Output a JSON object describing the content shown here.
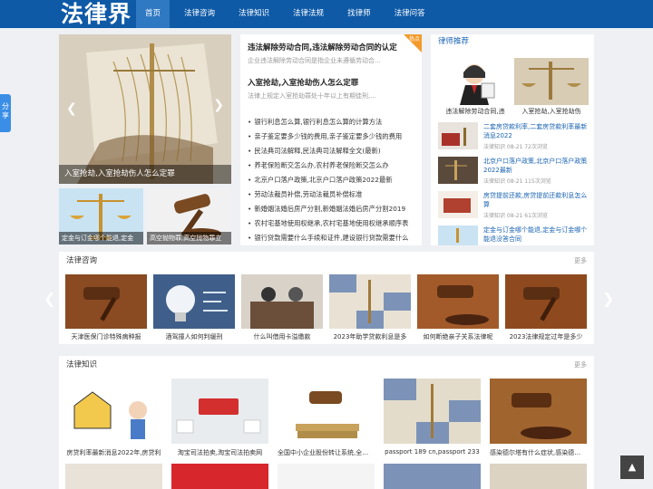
{
  "header": {
    "logo": "法律界",
    "nav": [
      "首页",
      "法律咨询",
      "法律知识",
      "法律法规",
      "找律师",
      "法律问答"
    ],
    "active_index": 0
  },
  "share": {
    "label": "分享"
  },
  "slider": {
    "caption": "入室抢劫,入室抢劫伤人怎么定罪",
    "prev_icon": "chevron-left-icon",
    "next_icon": "chevron-right-icon"
  },
  "thumbs": [
    {
      "caption": "定金与订金哪个能退,定金"
    },
    {
      "caption": "高空抛物罪,高空抛物罪立"
    }
  ],
  "headlines": [
    {
      "title": "违法解除劳动合同,违法解除劳动合同的认定",
      "summary": "企业违法解除劳动合同是指企业未遵循劳动合..."
    },
    {
      "title": "入室抢劫,入室抢劫伤人怎么定罪",
      "summary": "法律上规定入室抢劫罪处十年以上有期徒刑,..."
    }
  ],
  "hot_badge": "热点",
  "news_list": [
    "银行利息怎么算,银行利息怎么算的计算方法",
    "亲子鉴定要多少钱的费用,亲子鉴定要多少钱的费用",
    "民法典司法解释,民法典司法解释全文(最新)",
    "养老保险断交怎么办,农村养老保险断交怎么办",
    "北京户口落户政策,北京户口落户政策2022最新",
    "劳动法裁员补偿,劳动法裁员补偿标准",
    "新婚姻法婚后房产分割,新婚姻法婚后房产分割2019",
    "农村宅基地使用权继承,农村宅基地使用权继承顺序表",
    "银行贷款需要什么手续和证件,建设银行贷款需要什么"
  ],
  "lawyer": {
    "title": "律师推荐",
    "top": [
      {
        "caption": "违法解除劳动合同,违"
      },
      {
        "caption": "入室抢劫,入室抢劫伤"
      }
    ],
    "items": [
      {
        "title": "二套房贷款利率,二套房贷款利率最新消息2022",
        "meta": "法律知识  08-21  72次浏览"
      },
      {
        "title": "北京户口落户政策,北京户口落户政策2022最新",
        "meta": "法律知识  08-21  115次浏览"
      },
      {
        "title": "房贷提前还款,房贷提前还款利息怎么算",
        "meta": "法律知识  08-21  61次浏览"
      },
      {
        "title": "定金与订金哪个能退,定金与订金哪个能退没答合同",
        "meta": ""
      }
    ]
  },
  "consult": {
    "title": "法律咨询",
    "more": "更多",
    "cards": [
      "天津医保门诊特殊病种报",
      "酒驾撞人如何判缓刑",
      "什么叫借用卡溢缴款",
      "2023年助学贷款利息是多",
      "如何断绝亲子关系法律呢",
      "2023法律规定过年是多少"
    ]
  },
  "knowledge": {
    "title": "法律知识",
    "more": "更多",
    "cards": [
      "房贷利率最新消息2022年,房贷利",
      "淘宝司法拍卖,淘宝司法拍卖网",
      "全国中小企业股份转让系统,全国中",
      "passport 189 cn,passport 233",
      "感染德尔塔有什么症状,感染德尔塔"
    ]
  },
  "totop": {
    "label": "▲"
  }
}
